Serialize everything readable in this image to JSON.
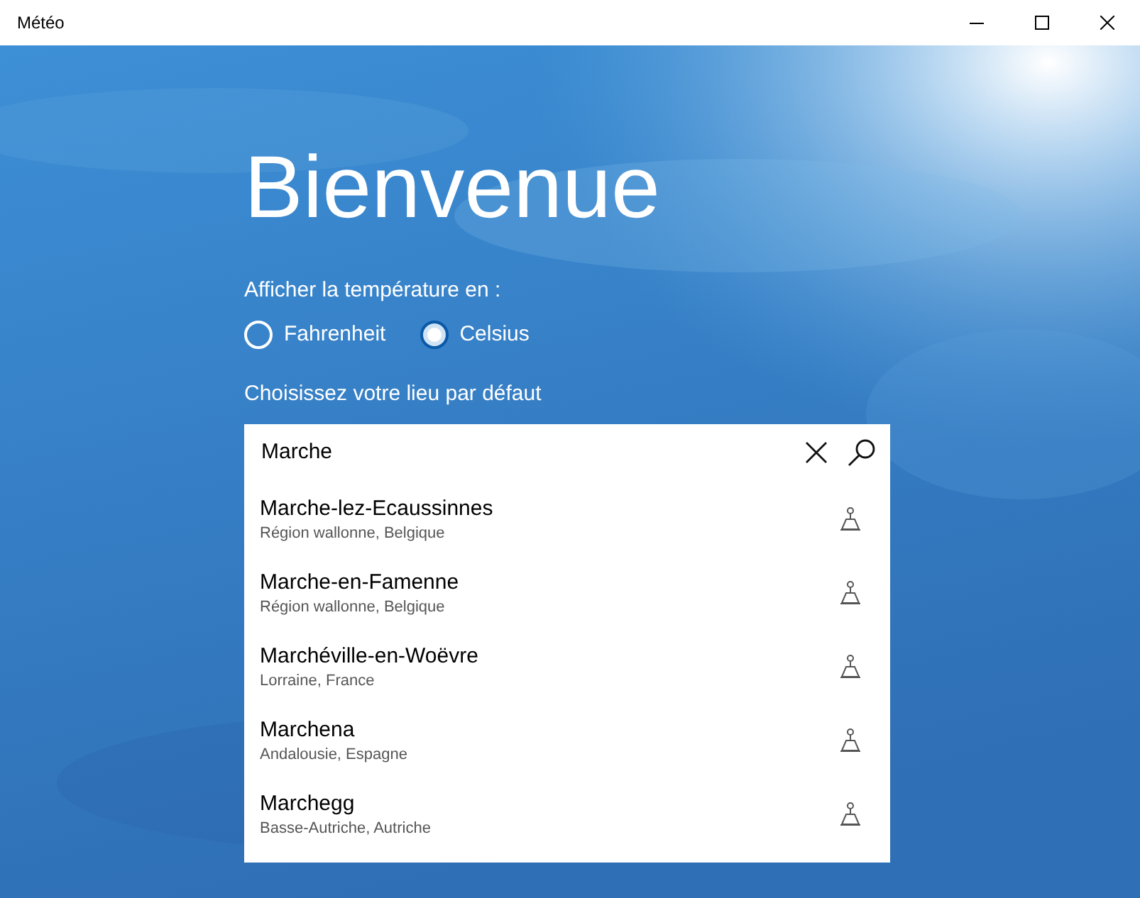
{
  "window": {
    "title": "Météo"
  },
  "heading": "Bienvenue",
  "temperature": {
    "label": "Afficher la température en :",
    "options": [
      {
        "label": "Fahrenheit",
        "selected": false
      },
      {
        "label": "Celsius",
        "selected": true
      }
    ]
  },
  "location": {
    "label": "Choisissez votre lieu par défaut",
    "search": {
      "value": "Marche"
    },
    "results": [
      {
        "name": "Marche-lez-Ecaussinnes",
        "region": "Région wallonne, Belgique"
      },
      {
        "name": "Marche-en-Famenne",
        "region": "Région wallonne, Belgique"
      },
      {
        "name": "Marchéville-en-Woëvre",
        "region": "Lorraine, France"
      },
      {
        "name": "Marchena",
        "region": "Andalousie, Espagne"
      },
      {
        "name": "Marchegg",
        "region": "Basse-Autriche, Autriche"
      }
    ]
  }
}
